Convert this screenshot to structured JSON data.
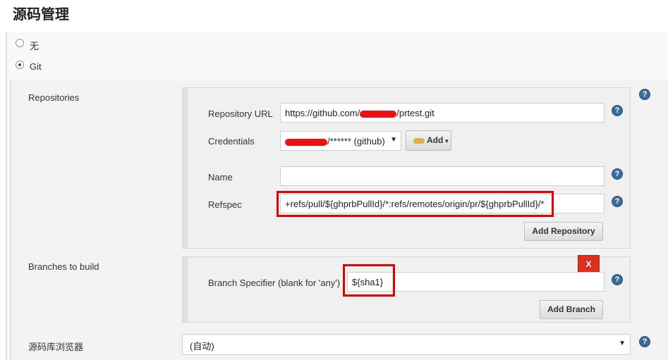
{
  "section": {
    "title": "源码管理"
  },
  "scm_options": [
    {
      "label": "无",
      "selected": false
    },
    {
      "label": "Git",
      "selected": true
    }
  ],
  "repositories": {
    "label": "Repositories",
    "url_label": "Repository URL",
    "url_prefix": "https://github.com/",
    "url_suffix": "/prtest.git",
    "credentials_label": "Credentials",
    "credentials_value": "/****** (github)",
    "add_button": "Add",
    "name_label": "Name",
    "name_value": "",
    "refspec_label": "Refspec",
    "refspec_value": "+refs/pull/${ghprbPullId}/*:refs/remotes/origin/pr/${ghprbPullId}/*",
    "add_repository_button": "Add Repository"
  },
  "branches": {
    "label": "Branches to build",
    "delete_button": "X",
    "specifier_label": "Branch Specifier (blank for 'any')",
    "specifier_value": "${sha1}",
    "add_branch_button": "Add Branch"
  },
  "browser": {
    "label": "源码库浏览器",
    "selected": "(自动)"
  },
  "colors": {
    "highlight": "#e00000",
    "redaction": "#ee1111",
    "help_icon": "#3b6b98",
    "delete_button": "#d9301f"
  }
}
